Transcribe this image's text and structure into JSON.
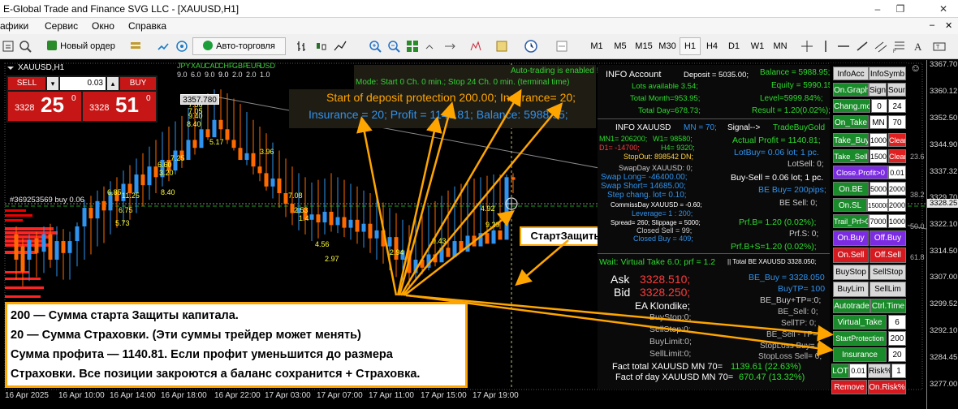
{
  "window": {
    "title": "E-Global Trade and Finance SVG LLC - [XAUUSD,H1]"
  },
  "menu": [
    "афики",
    "Сервис",
    "Окно",
    "Справка"
  ],
  "toolbar": {
    "new_order": "Новый ордер",
    "autotrade": "Авто-торговля",
    "timeframes": [
      "M1",
      "M5",
      "M15",
      "M30",
      "H1",
      "H4",
      "D1",
      "W1",
      "MN"
    ]
  },
  "chart": {
    "symbol": "XAUUSD,H1",
    "currencies": [
      "JPY",
      "XAU",
      "CAD",
      "CHF",
      "GBP",
      "EUR",
      "USD"
    ],
    "currency_vals": [
      "9.0",
      "6.0",
      "9.0",
      "9.0",
      "2.0",
      "2.0",
      "1.0"
    ],
    "order_label": "#369253569 buy 0.06",
    "price_box": "3357.780",
    "trade": {
      "sell": "SELL",
      "buy": "BUY",
      "lot": "0.03",
      "sell_big": "3328",
      "sell_px": "25",
      "sell_sup": "0",
      "buy_big": "3328",
      "buy_px": "51",
      "buy_sup": "0"
    },
    "autotrading": "Auto-trading is enabled !",
    "mode": "Mode: Start  0 Ch. 0 min.;  Stop  24 Ch. 0 min. (terminal time)",
    "deposit_line": "Start of deposit protection 200.00;  Insurance= 20;",
    "insurance_line": "Insurance = 20;  Profit = 1140.81;  Balance: 5988.95;",
    "callout": "СтартЗащиты",
    "note": [
      "200 — Сумма старта Защиты капитала.",
      "20 — Сумма Страховки. (Эти суммы трейдер может менять)",
      "Сумма профита — 1140.81. Если профит уменьшится до размера",
      "Страховки. Все позиции закроются а баланс сохранится + Страховка."
    ],
    "time_labels": [
      "16 Apr 2025",
      "16 Apr 10:00",
      "16 Apr 14:00",
      "16 Apr 18:00",
      "16 Apr 22:00",
      "17 Apr 03:00",
      "17 Apr 07:00",
      "17 Apr 11:00",
      "17 Apr 15:00",
      "17 Apr 19:00"
    ],
    "price_labels": [
      "3367.70",
      "3360.12",
      "3352.50",
      "3344.90",
      "3337.32",
      "3329.70",
      "3322.10",
      "3314.50",
      "3307.00",
      "3299.52",
      "3292.10",
      "3284.45",
      "3277.00"
    ],
    "current_price": "3328.25",
    "scale_marks": [
      "23.6",
      "38.2",
      "50.0",
      "61.8"
    ],
    "candle_labels": [
      "7.50",
      "7.05",
      "9.40",
      "8.40",
      "5.17",
      "7.25",
      "6.60",
      "3.20",
      "6.85",
      "11.25",
      "6.75",
      "5.73",
      "8.40",
      "3.96",
      "7.08",
      "2.53",
      "1.4",
      "4.56",
      "2.97",
      "2.94",
      "9.43",
      "4.92",
      "9.29"
    ]
  },
  "info_account": {
    "title": "INFO Account",
    "deposit": "Deposit = 5035.00;",
    "lots": "Lots available 3.54;",
    "total_month": "Total Month=953.95;",
    "total_day": "Total Day=678.73;",
    "balance": "Balance = 5988.95;",
    "equity": "Equity = 5990.15;",
    "level": "Level=5999.84%;",
    "result": "Result = 1.20(0.02%);"
  },
  "info_symbol": {
    "title": "INFO XAUUSD",
    "mn": "MN = 70;",
    "signal": "Signal-->",
    "signal_val": "TradeBuyGold",
    "mn1": "MN1= 206200;",
    "w1": "W1= 98580;",
    "d1": "D1= -14700;",
    "h4": "H4= 9320;",
    "stopout": "StopOut: 898542 DN;",
    "swapday": "SwapDay XAUUSD:  0;",
    "swap_long": "Swap Long= -46400.00;",
    "swap_short": "Swap Short= 14685.00;",
    "step": "Step chang. lot= 0.10;",
    "commission": "CommissDay XAUUSD = -0.60;",
    "leverage": "Leverage= 1 : 200;",
    "spread": "Spread= 260; Slippage = 5000;",
    "closed_sell": "Closed  Sell = 99;",
    "closed_buy": "Closed Buy = 409;",
    "actual_profit": "Actual Profit = 1140.81;",
    "lot_buy": "LotBuy= 0.06 lot; 1 pc.",
    "lot_sell": "LotSell: 0;",
    "buy_sell": "Buy-Sell = 0.06 lot; 1 pc.",
    "be_buy_pips": "BE Buy= 200pips;",
    "be_sell": "BE Sell: 0;",
    "prf_b": "Prf.B= 1.20 (0.02%);",
    "prf_s": "Prf.S: 0;",
    "prf_bs": "Prf.B+S=1.20 (0.02%);"
  },
  "wait_line": "Wait: Virtual Take 6.0; prf = 1.2",
  "total_be": "|| Total BE XAUUSD 3328.050;",
  "quotes": {
    "ask_label": "Ask",
    "ask": "3328.510;",
    "bid_label": "Bid",
    "bid": "3328.250;",
    "ea": "EA Klondike;",
    "left": [
      "BuyStop:0;",
      "SellStop:0;",
      "BuyLimit:0;",
      "SellLimit:0;"
    ],
    "be_buy": "BE_Buy = 3328.050",
    "buy_tp": "BuyTP= 100",
    "be_buy_tp": "BE_Buy+TP=:0;",
    "be_sell": "BE_Sell: 0;",
    "sell_tp": "SellTP: 0;",
    "be_sell_tp": "BE_Sell - TP= 0;",
    "stoploss_buy": "StopLoss Buy= 0;",
    "stoploss_sell": "StopLoss Sell= 0;",
    "fact_total_label": "Fact total   XAUUSD MN 70=",
    "fact_total": "1139.61 (22.63%)",
    "fact_day_label": "Fact of day XAUUSD MN 70=",
    "fact_day": "670.47 (13.32%)"
  },
  "buttons": {
    "info_acc": "InfoAcc",
    "info_symb": "InfoSymb",
    "on_graph": "On.Graph",
    "sign": "Sign",
    "soun": "Soun",
    "chang_mode": "Chang.mode",
    "v0": "0",
    "v24": "24",
    "on_take": "On_Take",
    "mn": "MN",
    "v70": "70",
    "take_buy": "Take_Buy",
    "v1000": "1000",
    "clear": "Clear",
    "take_sell": "Take_Sell",
    "v1500": "1500",
    "close_profit": "Close.Profit>0",
    "v001": "0.01",
    "on_be": "On.BE",
    "v5000": "5000",
    "v2000": "2000",
    "on_sl": "On.SL",
    "v150000": "150000",
    "v2000b": "2000",
    "trail": "Trail_Prf>0",
    "v7000": "7000",
    "v1000b": "1000",
    "on_buy": "On.Buy",
    "off_buy": "Off.Buy",
    "on_sell": "On.Sell",
    "off_sell": "Off.Sell",
    "buy_stop": "BuyStop",
    "sell_stop": "SellStop",
    "buy_lim": "BuyLim",
    "sell_lim": "SellLim",
    "autotrade": "Autotrade",
    "ctrl_time": "Ctrl.Time",
    "virtual_take": "Virtual_Take",
    "v6": "6",
    "start_protection": "StartProtection",
    "v200": "200",
    "insurance": "Insurance",
    "v20": "20",
    "lot": "LOT",
    "v001b": "0.01",
    "risk": "Risk%",
    "v1": "1",
    "remove": "Remove",
    "on_risk": "On.Risk%"
  },
  "colors": {
    "accent": "#ffa500",
    "green_btn": "#138f2e",
    "red_btn": "#d71920",
    "purple_btn": "#7b2be2"
  }
}
